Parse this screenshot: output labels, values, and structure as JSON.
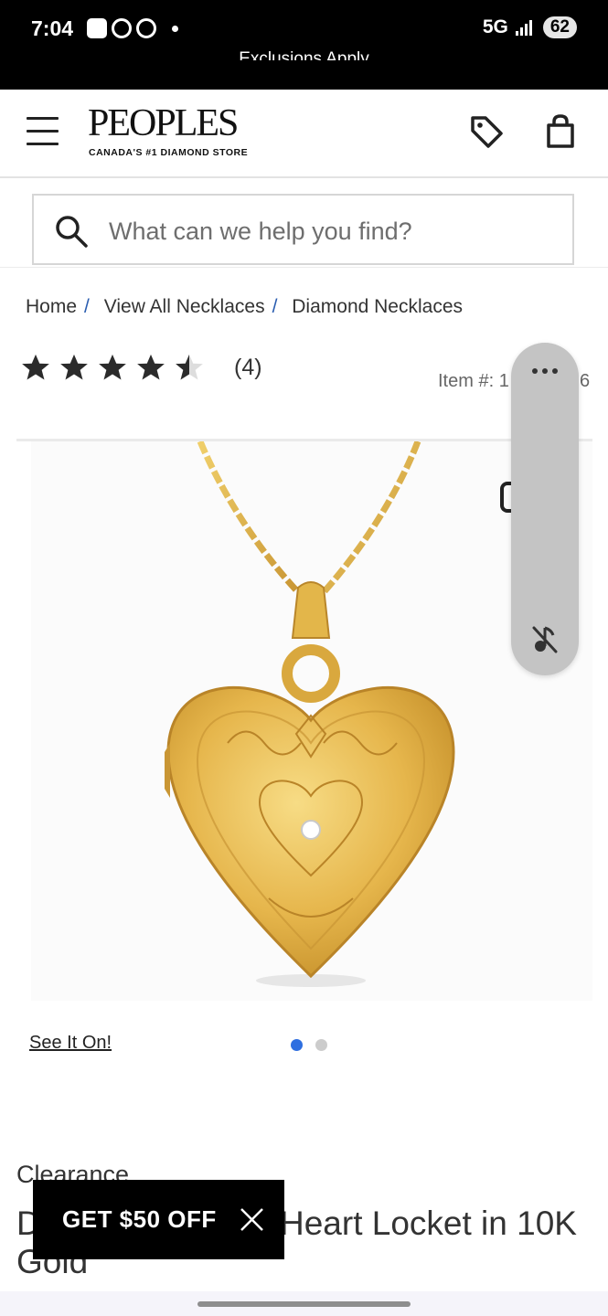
{
  "status_bar": {
    "time": "7:04",
    "network": "5G",
    "battery": "62"
  },
  "promo_banner": {
    "text": "Exclusions Apply"
  },
  "header": {
    "logo_title": "PEOPLES",
    "logo_subtitle": "CANADA'S #1 DIAMOND STORE"
  },
  "search": {
    "placeholder": "What can we help you find?"
  },
  "breadcrumb": [
    {
      "label": "Home"
    },
    {
      "label": "View All Necklaces"
    },
    {
      "label": "Diamond Necklaces"
    }
  ],
  "rating": {
    "stars": 4.5,
    "count": "(4)"
  },
  "item_number": {
    "prefix": "Item #: 1",
    "suffix": "6"
  },
  "gallery": {
    "see_it_on": "See It On!",
    "slide_count": 2,
    "active_slide": 1
  },
  "product": {
    "clearance_label": "Clearance",
    "title_start": "D",
    "title_end": "Heart Locket in 10K",
    "title_line2": "Gold"
  },
  "offer": {
    "label": "GET $50 OFF"
  },
  "colors": {
    "accent_blue": "#2f6fe0",
    "gold": "#e3b64a"
  }
}
